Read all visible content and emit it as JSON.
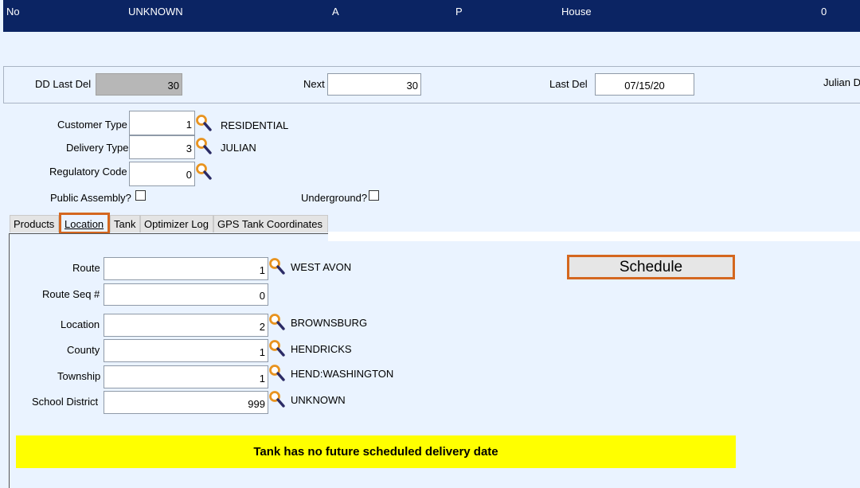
{
  "header": {
    "col1": "No",
    "col2": "UNKNOWN",
    "col3": "A",
    "col4": "P",
    "col5": "House",
    "col6": "0"
  },
  "delivery": {
    "dd_last_del_label": "DD Last Del",
    "dd_last_del_value": "30",
    "next_label": "Next",
    "next_value": "30",
    "last_del_label": "Last  Del",
    "last_del_value": "07/15/20",
    "julian_label": "Julian D"
  },
  "customer": {
    "customer_type_label": "Customer Type",
    "customer_type_value": "1",
    "customer_type_desc": "RESIDENTIAL",
    "delivery_type_label": "Delivery Type",
    "delivery_type_value": "3",
    "delivery_type_desc": "JULIAN",
    "regulatory_code_label": "Regulatory Code",
    "regulatory_code_value": "0",
    "public_assembly_label": "Public Assembly?",
    "underground_label": "Underground?"
  },
  "tabs": [
    {
      "label": "Products"
    },
    {
      "label": "Location"
    },
    {
      "label": "Tank"
    },
    {
      "label": "Optimizer Log"
    },
    {
      "label": "GPS Tank Coordinates"
    }
  ],
  "location": {
    "route_label": "Route",
    "route_value": "1",
    "route_desc": "WEST AVON",
    "route_seq_label": "Route Seq #",
    "route_seq_value": "0",
    "location_label": "Location",
    "location_value": "2",
    "location_desc": "BROWNSBURG",
    "county_label": "County",
    "county_value": "1",
    "county_desc": "HENDRICKS",
    "township_label": "Township",
    "township_value": "1",
    "township_desc": "HEND:WASHINGTON",
    "school_label": "School District",
    "school_value": "999",
    "school_desc": "UNKNOWN",
    "schedule_button": "Schedule",
    "warning": "Tank has no future scheduled delivery date"
  },
  "colors": {
    "header_bg": "#0b2463",
    "page_bg": "#eaf3ff",
    "highlight_border": "#d4671f",
    "warning_bg": "#ffff00"
  }
}
